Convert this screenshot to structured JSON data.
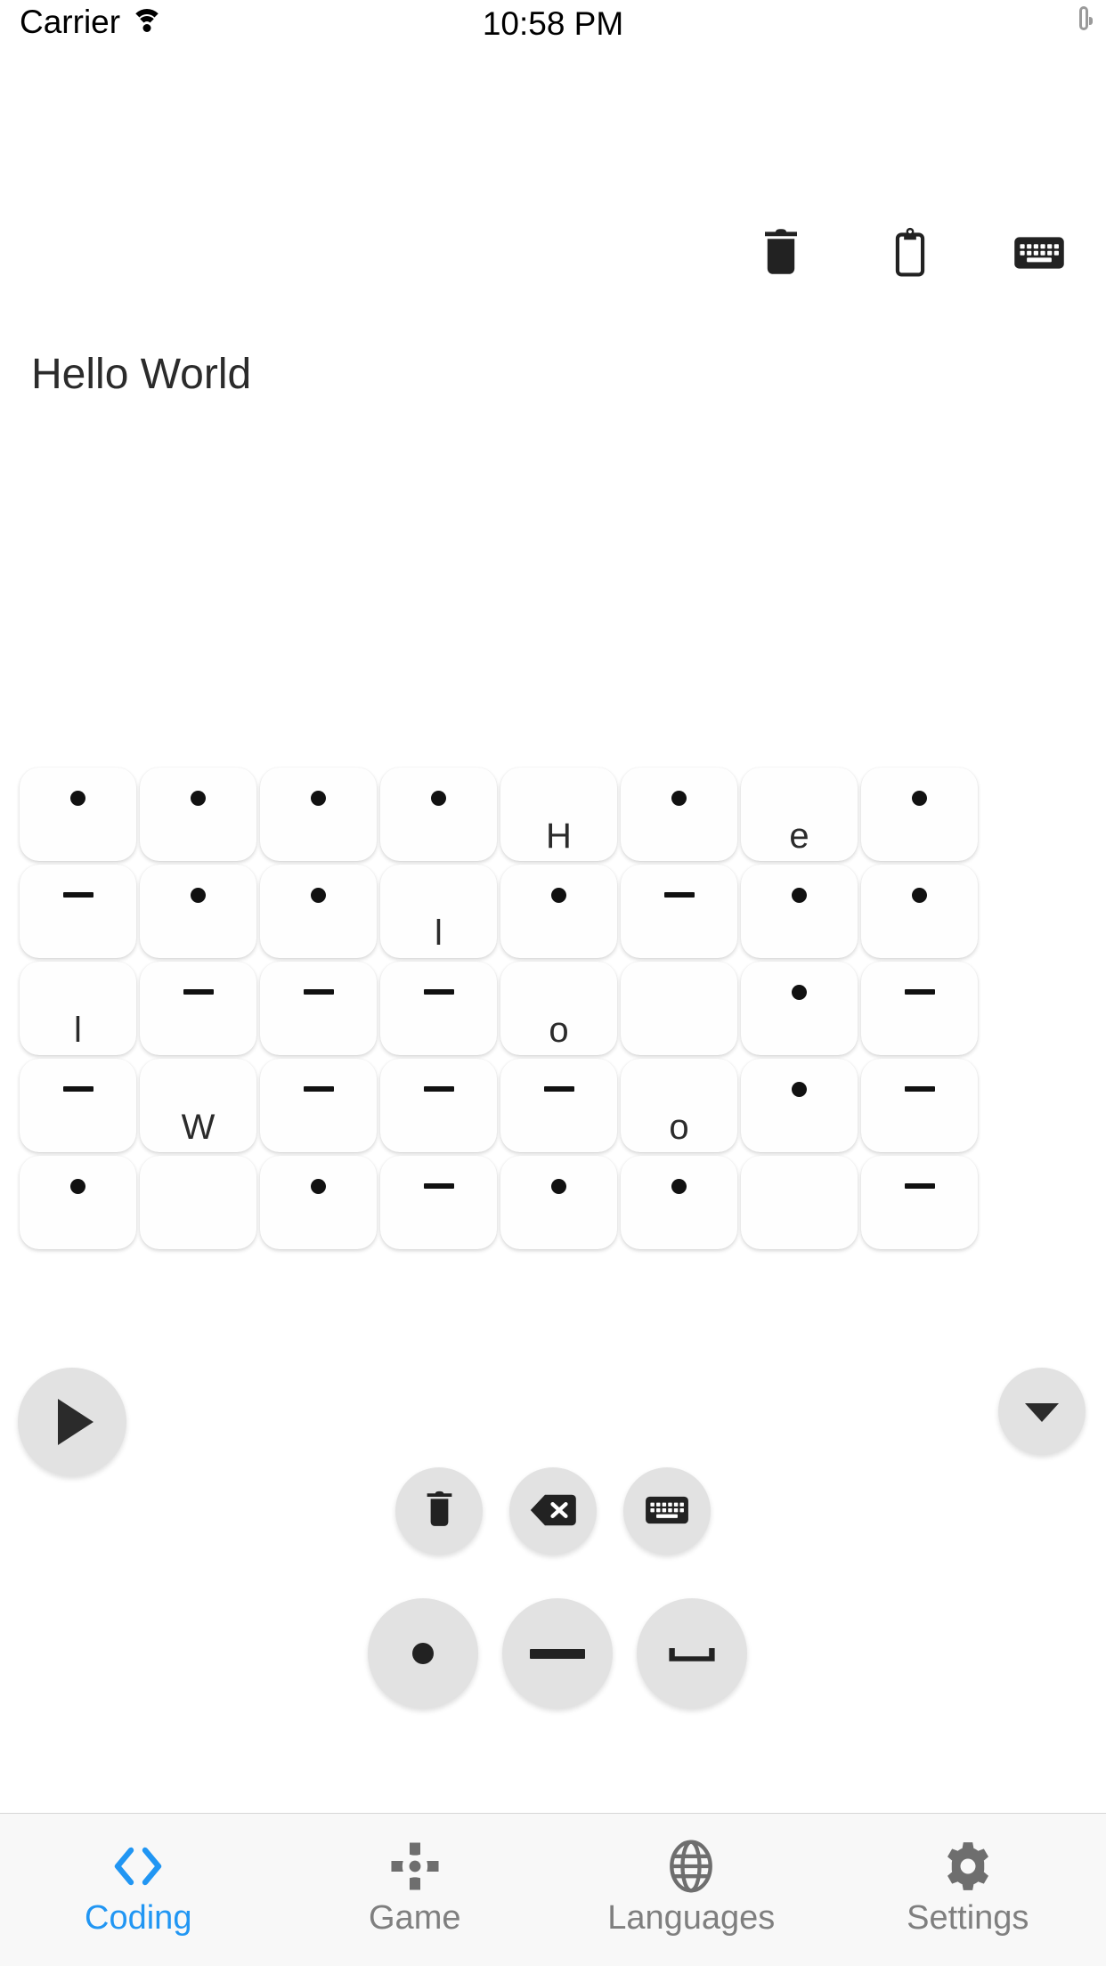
{
  "status_bar": {
    "carrier": "Carrier",
    "time": "10:58 PM",
    "wifi_icon": "wifi-icon",
    "battery_icon": "battery-icon"
  },
  "toolbar": {
    "items": [
      {
        "name": "clear-text-button",
        "icon": "trash-icon"
      },
      {
        "name": "copy-to-clipboard-button",
        "icon": "clipboard-icon"
      },
      {
        "name": "toggle-keyboard-button",
        "icon": "keyboard-icon"
      }
    ]
  },
  "output": {
    "text": "Hello World"
  },
  "morse_tree": {
    "columns": 8,
    "rows": [
      [
        {
          "symbol": "dot",
          "letter": ""
        },
        {
          "symbol": "dot",
          "letter": ""
        },
        {
          "symbol": "dot",
          "letter": ""
        },
        {
          "symbol": "dot",
          "letter": ""
        },
        {
          "symbol": "",
          "letter": "H"
        },
        {
          "symbol": "dot",
          "letter": ""
        },
        {
          "symbol": "",
          "letter": "e"
        },
        {
          "symbol": "dot",
          "letter": ""
        }
      ],
      [
        {
          "symbol": "dash",
          "letter": ""
        },
        {
          "symbol": "dot",
          "letter": ""
        },
        {
          "symbol": "dot",
          "letter": ""
        },
        {
          "symbol": "",
          "letter": "l"
        },
        {
          "symbol": "dot",
          "letter": ""
        },
        {
          "symbol": "dash",
          "letter": ""
        },
        {
          "symbol": "dot",
          "letter": ""
        },
        {
          "symbol": "dot",
          "letter": ""
        }
      ],
      [
        {
          "symbol": "",
          "letter": "l"
        },
        {
          "symbol": "dash",
          "letter": ""
        },
        {
          "symbol": "dash",
          "letter": ""
        },
        {
          "symbol": "dash",
          "letter": ""
        },
        {
          "symbol": "",
          "letter": "o"
        },
        {
          "symbol": "",
          "letter": ""
        },
        {
          "symbol": "dot",
          "letter": ""
        },
        {
          "symbol": "dash",
          "letter": ""
        }
      ],
      [
        {
          "symbol": "dash",
          "letter": ""
        },
        {
          "symbol": "",
          "letter": "W"
        },
        {
          "symbol": "dash",
          "letter": ""
        },
        {
          "symbol": "dash",
          "letter": ""
        },
        {
          "symbol": "dash",
          "letter": ""
        },
        {
          "symbol": "",
          "letter": "o"
        },
        {
          "symbol": "dot",
          "letter": ""
        },
        {
          "symbol": "dash",
          "letter": ""
        }
      ],
      [
        {
          "symbol": "dot",
          "letter": ""
        },
        {
          "symbol": "",
          "letter": ""
        },
        {
          "symbol": "dot",
          "letter": ""
        },
        {
          "symbol": "dash",
          "letter": ""
        },
        {
          "symbol": "dot",
          "letter": ""
        },
        {
          "symbol": "dot",
          "letter": ""
        },
        {
          "symbol": "",
          "letter": ""
        },
        {
          "symbol": "dash",
          "letter": ""
        }
      ]
    ]
  },
  "controls": {
    "play": {
      "name": "play-button",
      "icon": "play-triangle-icon"
    },
    "collapse": {
      "name": "collapse-button",
      "icon": "chevron-down-icon"
    },
    "small_row": [
      {
        "name": "clear-all-button",
        "icon": "trash-icon"
      },
      {
        "name": "backspace-button",
        "icon": "backspace-icon"
      },
      {
        "name": "keyboard-toggle-button",
        "icon": "keyboard-icon"
      }
    ],
    "big_row": [
      {
        "name": "dot-input-button",
        "icon": "dot-icon"
      },
      {
        "name": "dash-input-button",
        "icon": "dash-icon"
      },
      {
        "name": "space-input-button",
        "icon": "space-bar-icon"
      }
    ]
  },
  "tabbar": {
    "active_color": "#2196f3",
    "inactive_color": "#7f7f7f",
    "tabs": [
      {
        "label": "Coding",
        "icon": "code-brackets-icon",
        "active": true
      },
      {
        "label": "Game",
        "icon": "dpad-icon",
        "active": false
      },
      {
        "label": "Languages",
        "icon": "globe-icon",
        "active": false
      },
      {
        "label": "Settings",
        "icon": "gear-icon",
        "active": false
      }
    ]
  }
}
